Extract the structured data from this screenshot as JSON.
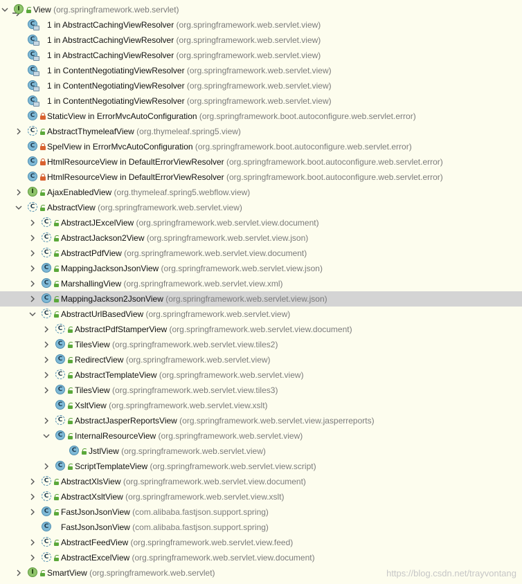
{
  "tree": [
    {
      "depth": 0,
      "arrow": "expanded",
      "icon": "interface",
      "vis": "public",
      "name": "View",
      "pkg": "(org.springframework.web.servlet)",
      "first": true
    },
    {
      "depth": 1,
      "arrow": "none",
      "icon": "anon",
      "vis": "none",
      "name": "1 in AbstractCachingViewResolver",
      "pkg": "(org.springframework.web.servlet.view)"
    },
    {
      "depth": 1,
      "arrow": "none",
      "icon": "anon",
      "vis": "none",
      "name": "1 in AbstractCachingViewResolver",
      "pkg": "(org.springframework.web.servlet.view)"
    },
    {
      "depth": 1,
      "arrow": "none",
      "icon": "anon",
      "vis": "none",
      "name": "1 in AbstractCachingViewResolver",
      "pkg": "(org.springframework.web.servlet.view)"
    },
    {
      "depth": 1,
      "arrow": "none",
      "icon": "anon",
      "vis": "none",
      "name": "1 in ContentNegotiatingViewResolver",
      "pkg": "(org.springframework.web.servlet.view)"
    },
    {
      "depth": 1,
      "arrow": "none",
      "icon": "anon",
      "vis": "none",
      "name": "1 in ContentNegotiatingViewResolver",
      "pkg": "(org.springframework.web.servlet.view)"
    },
    {
      "depth": 1,
      "arrow": "none",
      "icon": "anon",
      "vis": "none",
      "name": "1 in ContentNegotiatingViewResolver",
      "pkg": "(org.springframework.web.servlet.view)"
    },
    {
      "depth": 1,
      "arrow": "none",
      "icon": "class",
      "vis": "private",
      "name": "StaticView in ErrorMvcAutoConfiguration",
      "pkg": "(org.springframework.boot.autoconfigure.web.servlet.error)"
    },
    {
      "depth": 1,
      "arrow": "collapsed",
      "icon": "abstract",
      "vis": "public",
      "name": "AbstractThymeleafView",
      "pkg": "(org.thymeleaf.spring5.view)"
    },
    {
      "depth": 1,
      "arrow": "none",
      "icon": "class",
      "vis": "private",
      "name": "SpelView in ErrorMvcAutoConfiguration",
      "pkg": "(org.springframework.boot.autoconfigure.web.servlet.error)"
    },
    {
      "depth": 1,
      "arrow": "none",
      "icon": "class",
      "vis": "private",
      "name": "HtmlResourceView in DefaultErrorViewResolver",
      "pkg": "(org.springframework.boot.autoconfigure.web.servlet.error)"
    },
    {
      "depth": 1,
      "arrow": "none",
      "icon": "class",
      "vis": "private",
      "name": "HtmlResourceView in DefaultErrorViewResolver",
      "pkg": "(org.springframework.boot.autoconfigure.web.servlet.error)"
    },
    {
      "depth": 1,
      "arrow": "collapsed",
      "icon": "interface",
      "vis": "public",
      "name": "AjaxEnabledView",
      "pkg": "(org.thymeleaf.spring5.webflow.view)"
    },
    {
      "depth": 1,
      "arrow": "expanded",
      "icon": "abstract",
      "vis": "public",
      "name": "AbstractView",
      "pkg": "(org.springframework.web.servlet.view)"
    },
    {
      "depth": 2,
      "arrow": "collapsed",
      "icon": "abstract",
      "vis": "public",
      "name": "AbstractJExcelView",
      "pkg": "(org.springframework.web.servlet.view.document)"
    },
    {
      "depth": 2,
      "arrow": "collapsed",
      "icon": "abstract",
      "vis": "public",
      "name": "AbstractJackson2View",
      "pkg": "(org.springframework.web.servlet.view.json)"
    },
    {
      "depth": 2,
      "arrow": "collapsed",
      "icon": "abstract",
      "vis": "public",
      "name": "AbstractPdfView",
      "pkg": "(org.springframework.web.servlet.view.document)"
    },
    {
      "depth": 2,
      "arrow": "collapsed",
      "icon": "class",
      "vis": "public",
      "name": "MappingJacksonJsonView",
      "pkg": "(org.springframework.web.servlet.view.json)"
    },
    {
      "depth": 2,
      "arrow": "collapsed",
      "icon": "class",
      "vis": "public",
      "name": "MarshallingView",
      "pkg": "(org.springframework.web.servlet.view.xml)"
    },
    {
      "depth": 2,
      "arrow": "collapsed",
      "icon": "class",
      "vis": "public",
      "name": "MappingJackson2JsonView",
      "pkg": "(org.springframework.web.servlet.view.json)",
      "selected": true
    },
    {
      "depth": 2,
      "arrow": "expanded",
      "icon": "abstract",
      "vis": "public",
      "name": "AbstractUrlBasedView",
      "pkg": "(org.springframework.web.servlet.view)"
    },
    {
      "depth": 3,
      "arrow": "collapsed",
      "icon": "abstract",
      "vis": "public",
      "name": "AbstractPdfStamperView",
      "pkg": "(org.springframework.web.servlet.view.document)"
    },
    {
      "depth": 3,
      "arrow": "collapsed",
      "icon": "class",
      "vis": "public",
      "name": "TilesView",
      "pkg": "(org.springframework.web.servlet.view.tiles2)"
    },
    {
      "depth": 3,
      "arrow": "collapsed",
      "icon": "class",
      "vis": "public",
      "name": "RedirectView",
      "pkg": "(org.springframework.web.servlet.view)"
    },
    {
      "depth": 3,
      "arrow": "collapsed",
      "icon": "abstract",
      "vis": "public",
      "name": "AbstractTemplateView",
      "pkg": "(org.springframework.web.servlet.view)"
    },
    {
      "depth": 3,
      "arrow": "collapsed",
      "icon": "class",
      "vis": "public",
      "name": "TilesView",
      "pkg": "(org.springframework.web.servlet.view.tiles3)"
    },
    {
      "depth": 3,
      "arrow": "none",
      "icon": "class",
      "vis": "public",
      "name": "XsltView",
      "pkg": "(org.springframework.web.servlet.view.xslt)"
    },
    {
      "depth": 3,
      "arrow": "collapsed",
      "icon": "abstract",
      "vis": "public",
      "name": "AbstractJasperReportsView",
      "pkg": "(org.springframework.web.servlet.view.jasperreports)"
    },
    {
      "depth": 3,
      "arrow": "expanded",
      "icon": "class",
      "vis": "public",
      "name": "InternalResourceView",
      "pkg": "(org.springframework.web.servlet.view)"
    },
    {
      "depth": 4,
      "arrow": "none",
      "icon": "class",
      "vis": "public",
      "name": "JstlView",
      "pkg": "(org.springframework.web.servlet.view)"
    },
    {
      "depth": 3,
      "arrow": "collapsed",
      "icon": "class",
      "vis": "public",
      "name": "ScriptTemplateView",
      "pkg": "(org.springframework.web.servlet.view.script)"
    },
    {
      "depth": 2,
      "arrow": "collapsed",
      "icon": "abstract",
      "vis": "public",
      "name": "AbstractXlsView",
      "pkg": "(org.springframework.web.servlet.view.document)"
    },
    {
      "depth": 2,
      "arrow": "collapsed",
      "icon": "abstract",
      "vis": "public",
      "name": "AbstractXsltView",
      "pkg": "(org.springframework.web.servlet.view.xslt)"
    },
    {
      "depth": 2,
      "arrow": "collapsed",
      "icon": "class",
      "vis": "public",
      "name": "FastJsonJsonView",
      "pkg": "(com.alibaba.fastjson.support.spring)"
    },
    {
      "depth": 2,
      "arrow": "none",
      "icon": "class",
      "vis": "none",
      "name": "FastJsonJsonView",
      "pkg": "(com.alibaba.fastjson.support.spring)"
    },
    {
      "depth": 2,
      "arrow": "collapsed",
      "icon": "abstract",
      "vis": "public",
      "name": "AbstractFeedView",
      "pkg": "(org.springframework.web.servlet.view.feed)"
    },
    {
      "depth": 2,
      "arrow": "collapsed",
      "icon": "abstract",
      "vis": "public",
      "name": "AbstractExcelView",
      "pkg": "(org.springframework.web.servlet.view.document)"
    },
    {
      "depth": 1,
      "arrow": "collapsed",
      "icon": "interface",
      "vis": "public",
      "name": "SmartView",
      "pkg": "(org.springframework.web.servlet)"
    }
  ],
  "icon_letters": {
    "class": "C",
    "interface": "I",
    "abstract": "C",
    "anon": "C"
  },
  "watermark": "https://blog.csdn.net/trayvontang"
}
